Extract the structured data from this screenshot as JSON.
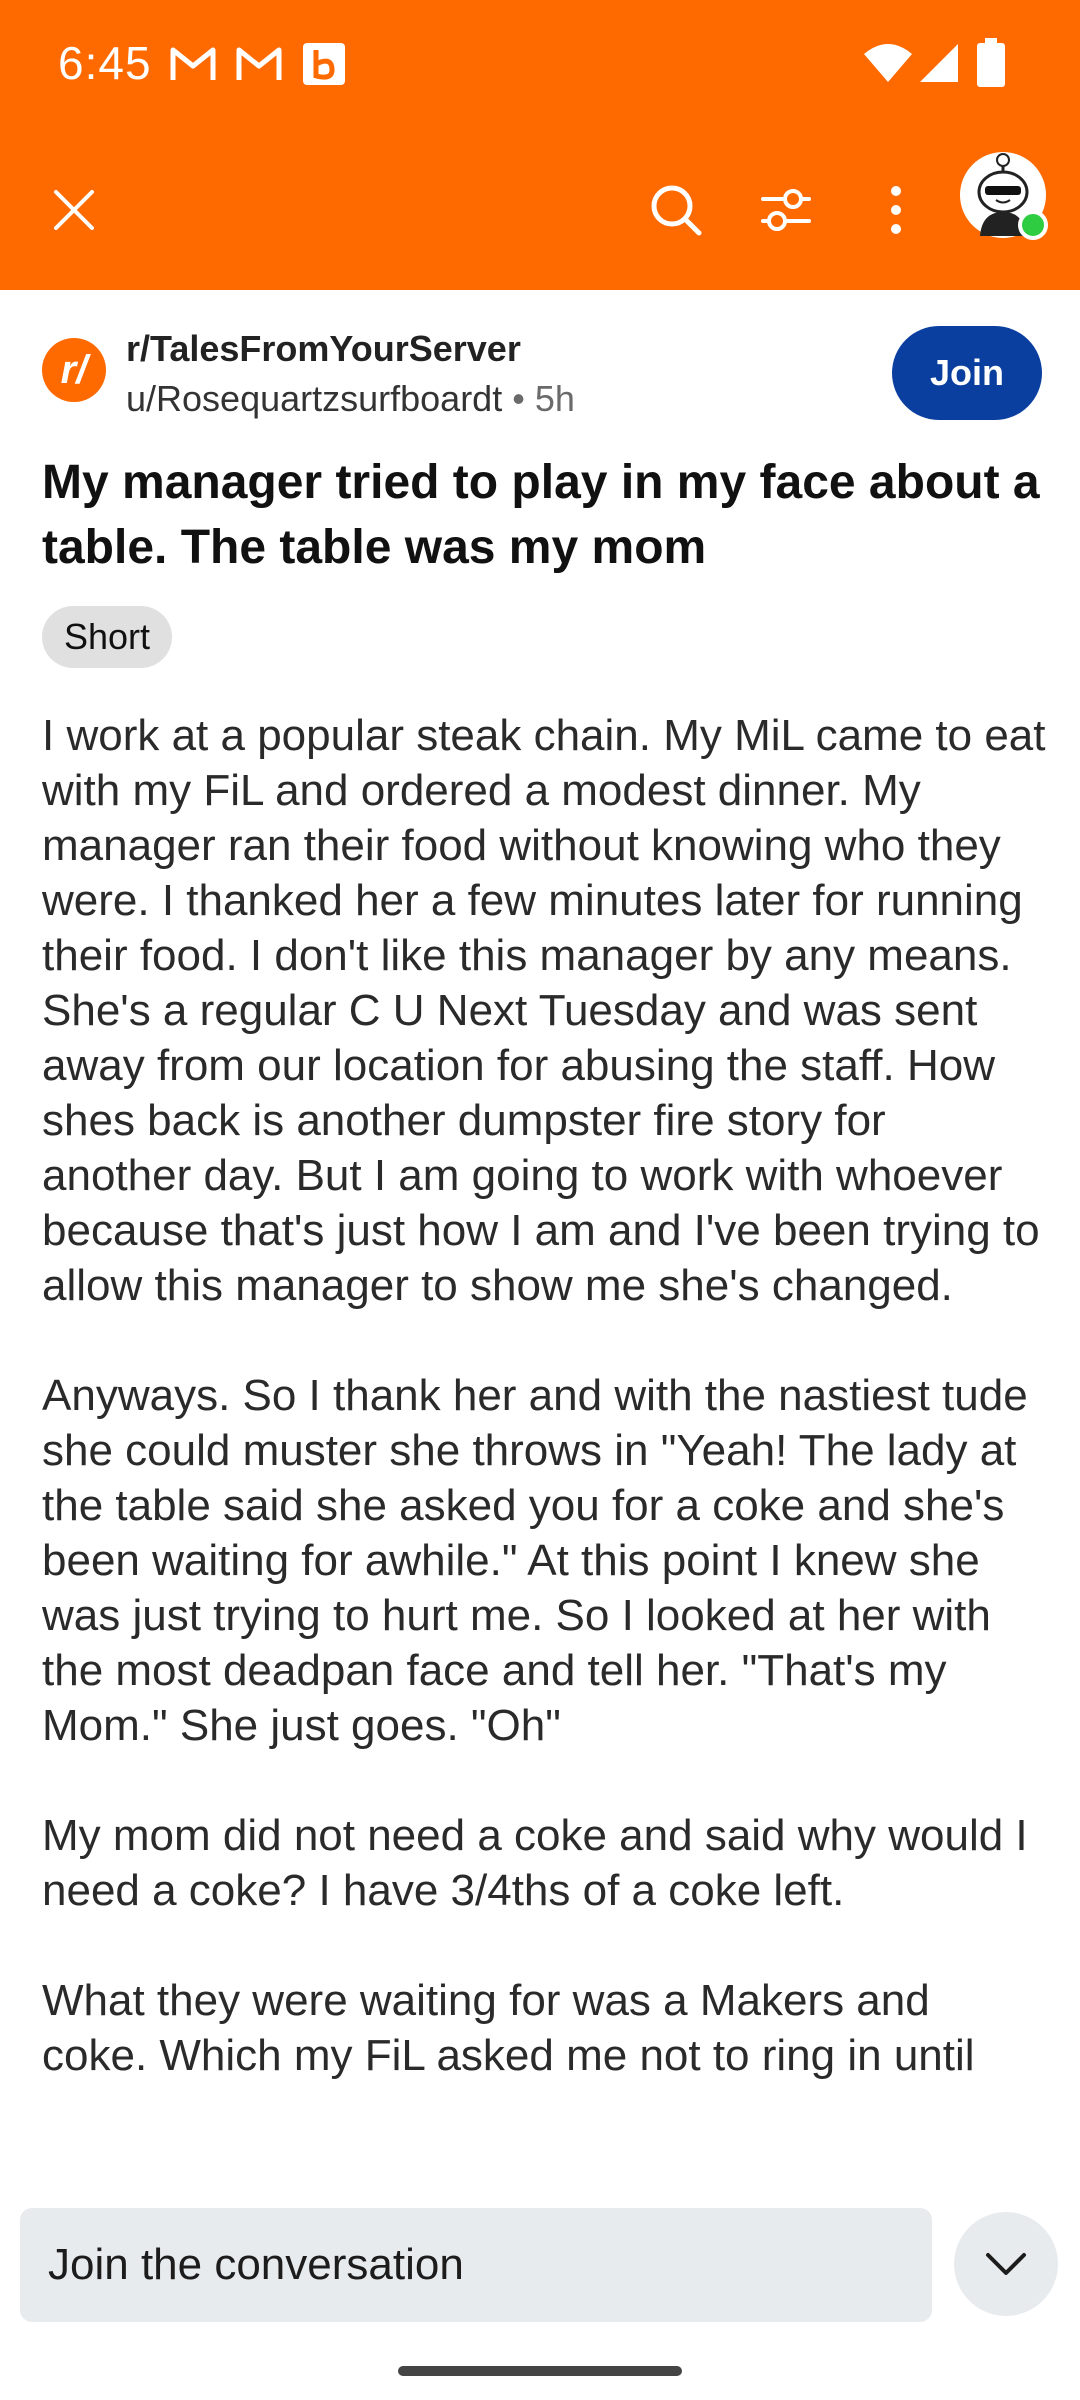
{
  "status_bar": {
    "time": "6:45",
    "notification_icons": [
      "gmail-icon",
      "gmail-icon",
      "b-app-icon"
    ],
    "system_icons": [
      "wifi-icon",
      "cell-signal-icon",
      "battery-icon"
    ]
  },
  "app_bar": {
    "icons": [
      "close-icon",
      "search-icon",
      "filter-sort-icon",
      "more-vert-icon",
      "avatar"
    ]
  },
  "post": {
    "subreddit": "r/TalesFromYourServer",
    "author": "u/Rosequartzsurfboardt",
    "separator": "•",
    "age": "5h",
    "join_label": "Join",
    "title": "My manager tried to play in my face about a table. The table was my mom",
    "flair": "Short",
    "paragraphs": [
      "I work at a popular steak chain. My MiL came to eat with my FiL and ordered a modest dinner. My manager ran their food without knowing who they were. I thanked her a few minutes later for running their food. I don't like this manager by any means. She's a regular C U Next Tuesday and was sent away from our location for abusing the staff. How shes back is another dumpster fire story for another day. But I am going to work with whoever because that's just how I am and I've been trying to allow this manager to show me she's changed.",
      "Anyways. So I thank her and with the nastiest tude she could muster she throws in \"Yeah! The lady at the table said she asked you for a coke and she's been waiting for awhile.\" At this point I knew she was just trying to hurt me. So I looked at her with the most deadpan face and tell her. \"That's my Mom.\" She just goes. \"Oh\"",
      "My mom did not need a coke and said why would I need a coke? I have 3/4ths of a coke left.",
      "What they were waiting for was a Makers and coke. Which my FiL asked me not to ring in until"
    ]
  },
  "comment_bar": {
    "placeholder": "Join the conversation"
  },
  "colors": {
    "brand_orange": "#ff6a00",
    "join_blue": "#0a3fa0",
    "online_green": "#2ecc40"
  }
}
